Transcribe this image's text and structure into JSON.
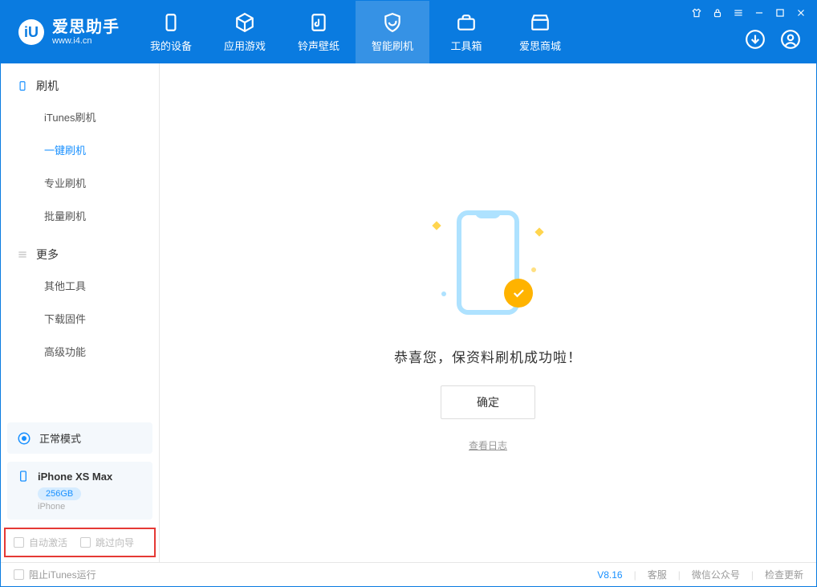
{
  "header": {
    "app_title": "爱思助手",
    "app_site": "www.i4.cn",
    "tabs": [
      {
        "label": "我的设备"
      },
      {
        "label": "应用游戏"
      },
      {
        "label": "铃声壁纸"
      },
      {
        "label": "智能刷机"
      },
      {
        "label": "工具箱"
      },
      {
        "label": "爱思商城"
      }
    ]
  },
  "sidebar": {
    "section1_title": "刷机",
    "items1": [
      {
        "label": "iTunes刷机"
      },
      {
        "label": "一键刷机"
      },
      {
        "label": "专业刷机"
      },
      {
        "label": "批量刷机"
      }
    ],
    "section2_title": "更多",
    "items2": [
      {
        "label": "其他工具"
      },
      {
        "label": "下载固件"
      },
      {
        "label": "高级功能"
      }
    ],
    "mode_label": "正常模式",
    "device_name": "iPhone XS Max",
    "device_capacity": "256GB",
    "device_type": "iPhone",
    "opt_auto_activate": "自动激活",
    "opt_skip_guide": "跳过向导"
  },
  "main": {
    "success_text": "恭喜您，保资料刷机成功啦！",
    "ok_label": "确定",
    "view_log": "查看日志"
  },
  "footer": {
    "block_itunes": "阻止iTunes运行",
    "version": "V8.16",
    "links": [
      "客服",
      "微信公众号",
      "检查更新"
    ]
  }
}
